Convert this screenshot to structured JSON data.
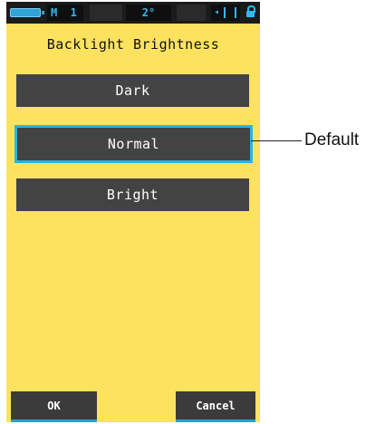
{
  "status_bar": {
    "battery_icon": "battery-icon",
    "mode": "M  1",
    "angle": "2°",
    "signal_icon": "signal-icon",
    "lock_icon": "lock-icon"
  },
  "screen": {
    "title": "Backlight Brightness",
    "options": [
      {
        "label": "Dark",
        "selected": false
      },
      {
        "label": "Normal",
        "selected": true
      },
      {
        "label": "Bright",
        "selected": false
      }
    ]
  },
  "callout": {
    "label": "Default"
  },
  "footer": {
    "ok_label": "OK",
    "cancel_label": "Cancel"
  },
  "colors": {
    "background": "#fce25f",
    "button": "#434343",
    "selection_accent": "#25b6e4",
    "status_accent": "#33b7f0"
  }
}
